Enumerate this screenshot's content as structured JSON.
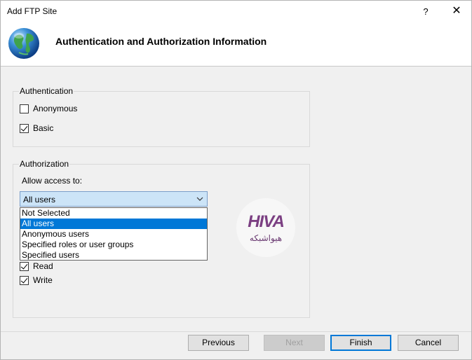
{
  "window": {
    "title": "Add FTP Site",
    "help_label": "?",
    "close_label": "✕"
  },
  "header": {
    "title": "Authentication and Authorization Information"
  },
  "authentication": {
    "label": "Authentication",
    "options": [
      {
        "label": "Anonymous",
        "checked": false
      },
      {
        "label": "Basic",
        "checked": true
      }
    ]
  },
  "authorization": {
    "label": "Authorization",
    "allow_access_label": "Allow access to:",
    "selected_value": "All users",
    "dropdown_options": [
      "Not Selected",
      "All users",
      "Anonymous users",
      "Specified roles or user groups",
      "Specified users"
    ],
    "selected_index": 1,
    "permissions": [
      {
        "label": "Read",
        "checked": true
      },
      {
        "label": "Write",
        "checked": true
      }
    ]
  },
  "watermark": {
    "top": "HIVA",
    "bottom": "هیواشبکه"
  },
  "buttons": {
    "previous": "Previous",
    "next": "Next",
    "finish": "Finish",
    "cancel": "Cancel"
  }
}
